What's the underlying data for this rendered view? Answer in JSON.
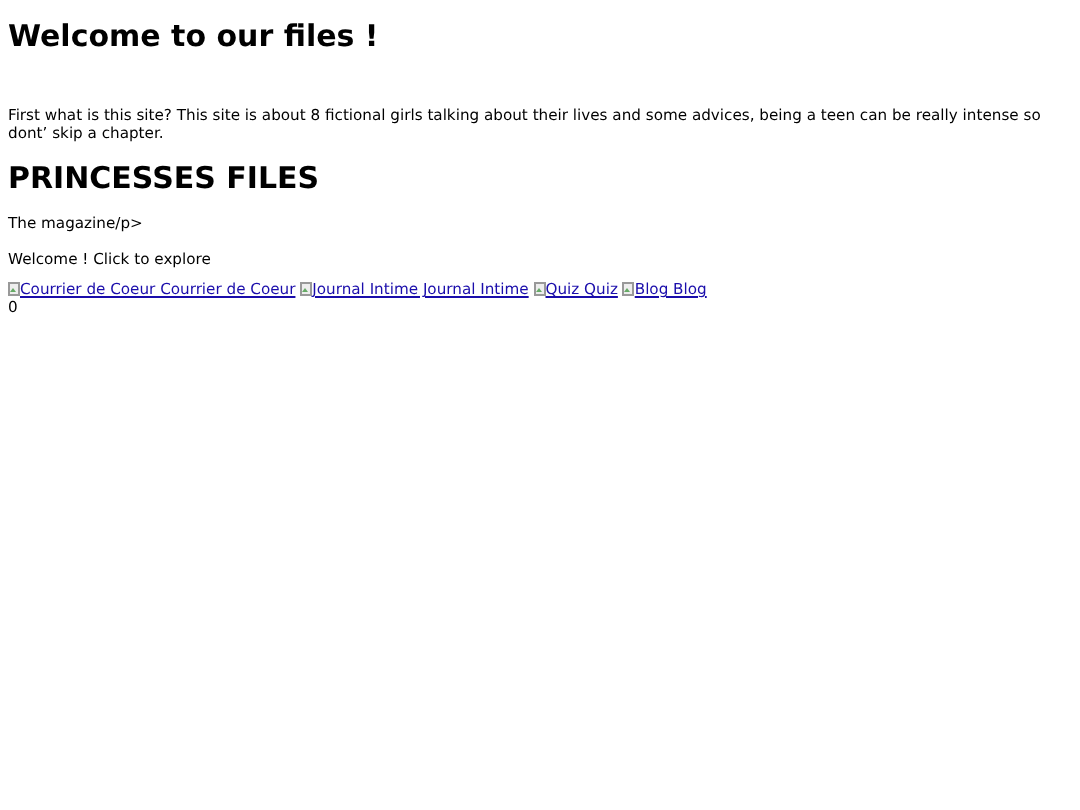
{
  "title": "Welcome to our files !",
  "intro": "First what is this site? This site is about 8 fictional girls talking about their lives and some advices, being a teen can be really intense so dont’ skip a chapter.",
  "heading": "PRINCESSES FILES",
  "tagline": "The magazine/p>",
  "welcome": "Welcome ! Click to explore",
  "links": [
    {
      "alt": "Courrier de Coeur",
      "label": "Courrier de Coeur"
    },
    {
      "alt": "Journal Intime",
      "label": "Journal Intime"
    },
    {
      "alt": "Quiz",
      "label": "Quiz"
    },
    {
      "alt": "Blog",
      "label": "Blog"
    }
  ],
  "counter": "0"
}
